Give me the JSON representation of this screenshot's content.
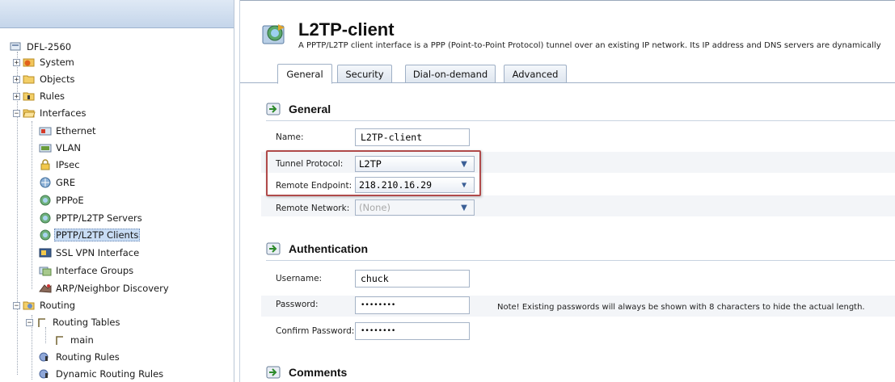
{
  "sidebar": {
    "root": {
      "label": "DFL-2560",
      "icon": "device-icon"
    },
    "items": [
      {
        "label": "System",
        "icon": "system-icon",
        "expander": "+"
      },
      {
        "label": "Objects",
        "icon": "folder-icon",
        "expander": "+"
      },
      {
        "label": "Rules",
        "icon": "rules-icon",
        "expander": "+"
      },
      {
        "label": "Interfaces",
        "icon": "folder-open-icon",
        "expander": "−"
      },
      {
        "label": "Ethernet",
        "icon": "ethernet-icon"
      },
      {
        "label": "VLAN",
        "icon": "vlan-icon"
      },
      {
        "label": "IPsec",
        "icon": "lock-icon"
      },
      {
        "label": "GRE",
        "icon": "gre-icon"
      },
      {
        "label": "PPPoE",
        "icon": "network-globe-icon"
      },
      {
        "label": "PPTP/L2TP Servers",
        "icon": "network-globe-icon"
      },
      {
        "label": "PPTP/L2TP Clients",
        "icon": "network-globe-icon"
      },
      {
        "label": "SSL VPN Interface",
        "icon": "ssl-vpn-icon"
      },
      {
        "label": "Interface Groups",
        "icon": "interface-groups-icon"
      },
      {
        "label": "ARP/Neighbor Discovery",
        "icon": "arp-icon"
      },
      {
        "label": "Routing",
        "icon": "routing-icon",
        "expander": "−"
      },
      {
        "label": "Routing Tables",
        "icon": "routing-table-icon",
        "expander": "−"
      },
      {
        "label": "main",
        "icon": "route-main-icon"
      },
      {
        "label": "Routing Rules",
        "icon": "routing-rules-icon"
      },
      {
        "label": "Dynamic Routing Rules",
        "icon": "routing-rules-icon"
      }
    ],
    "selected": "PPTP/L2TP Clients"
  },
  "header": {
    "title": "L2TP-client",
    "subtitle": "A PPTP/L2TP client interface is a PPP (Point-to-Point Protocol) tunnel over an existing IP network. Its IP address and DNS servers are dynamically"
  },
  "tabs": [
    {
      "label": "General",
      "active": true
    },
    {
      "label": "Security",
      "active": false
    },
    {
      "label": "Dial-on-demand",
      "active": false
    },
    {
      "label": "Advanced",
      "active": false
    }
  ],
  "general": {
    "section_title": "General",
    "name_label": "Name:",
    "name_value": "L2TP-client",
    "tunnel_protocol_label": "Tunnel Protocol:",
    "tunnel_protocol_value": "L2TP",
    "remote_endpoint_label": "Remote Endpoint:",
    "remote_endpoint_value": "218.210.16.29",
    "remote_network_label": "Remote Network:",
    "remote_network_value": "(None)"
  },
  "authentication": {
    "section_title": "Authentication",
    "username_label": "Username:",
    "username_value": "chuck",
    "password_label": "Password:",
    "password_value": "••••••••",
    "confirm_password_label": "Confirm Password:",
    "confirm_password_value": "••••••••",
    "note": "Note! Existing passwords will always be shown with 8 characters to hide the actual length."
  },
  "comments": {
    "section_title": "Comments"
  },
  "colors": {
    "highlight_border": "#b04a4a",
    "selection_bg": "#c8dcf4",
    "select_arrow": "#3b5f96"
  }
}
